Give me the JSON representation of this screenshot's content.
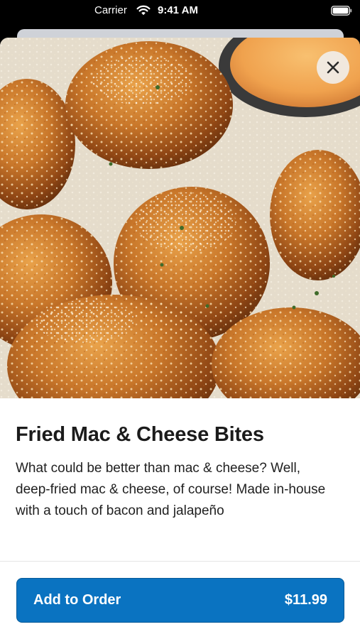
{
  "status_bar": {
    "carrier": "Carrier",
    "time": "9:41 AM"
  },
  "item": {
    "title": "Fried Mac & Cheese Bites",
    "description": "What could be better than mac & cheese? Well, deep-fried mac & cheese, of course! Made in-house with a touch of bacon and jalapeño"
  },
  "order_button": {
    "label": "Add to Order",
    "price": "$11.99"
  },
  "icons": {
    "close": "close-icon",
    "wifi": "wifi-icon",
    "battery": "battery-icon"
  },
  "colors": {
    "accent": "#0a73c1",
    "text": "#1b1b1b"
  }
}
